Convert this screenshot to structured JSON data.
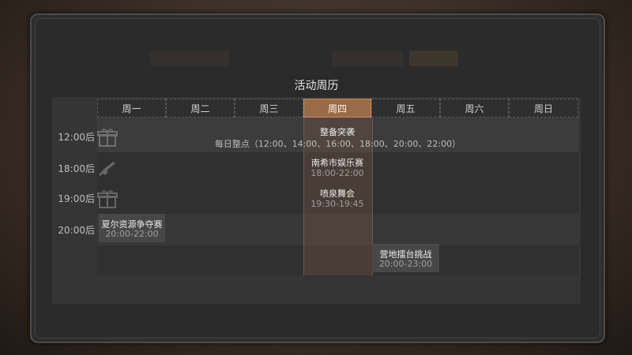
{
  "panel": {
    "title": "活动周历"
  },
  "days": [
    "周一",
    "周二",
    "周三",
    "周四",
    "周五",
    "周六",
    "周日"
  ],
  "active_day": "周四",
  "time_rows": [
    "12:00后",
    "18:00后",
    "19:00后",
    "20:00后"
  ],
  "row_icons": [
    "gift-icon",
    "rifle-icon",
    "gift-icon"
  ],
  "events": [
    {
      "title": "整备突袭",
      "subtitle": "每日整点（12:00、14:00、16:00、18:00、20:00、22:00）"
    },
    {
      "title": "南希市娱乐赛",
      "time": "18:00-22:00"
    },
    {
      "title": "喷泉舞会",
      "time": "19:30-19:45"
    },
    {
      "title": "夏尔资源争夺赛",
      "time": "20:00-22:00"
    },
    {
      "title": "营地擂台挑战",
      "time": "20:00-23:00"
    }
  ],
  "colors": {
    "active_header": "#9a6b48",
    "panel_bg": "#353535"
  }
}
